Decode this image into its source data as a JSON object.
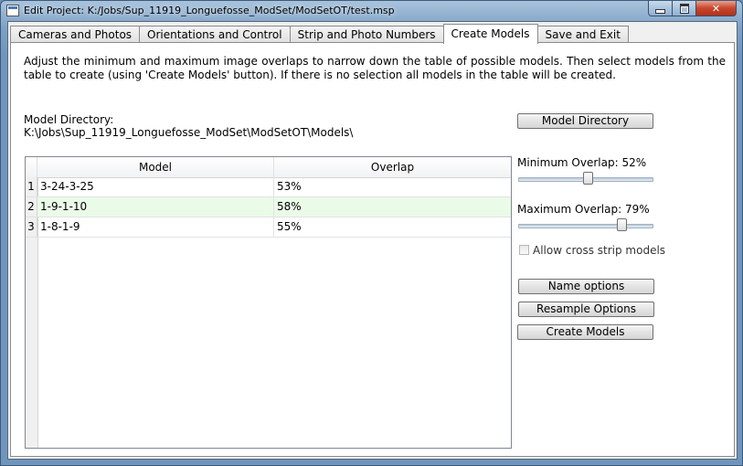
{
  "window": {
    "title": "Edit Project:  K:/Jobs/Sup_11919_Longuefosse_ModSet/ModSetOT/test.msp"
  },
  "tabs": [
    {
      "label": "Cameras and Photos",
      "active": false
    },
    {
      "label": "Orientations and Control",
      "active": false
    },
    {
      "label": "Strip and Photo Numbers",
      "active": false
    },
    {
      "label": "Create Models",
      "active": true
    },
    {
      "label": "Save and Exit",
      "active": false
    }
  ],
  "panel": {
    "instructions": "Adjust the minimum and maximum image overlaps to narrow down the table of possible models.  Then select models from the table to create (using 'Create Models' button).  If there is no selection all models in the table will be created.",
    "model_directory_label": "Model Directory:",
    "model_directory_path": "K:\\Jobs\\Sup_11919_Longuefosse_ModSet\\ModSetOT\\Models\\"
  },
  "table": {
    "columns": [
      "Model",
      "Overlap"
    ],
    "rows": [
      {
        "num": "1",
        "model": "3-24-3-25",
        "overlap": "53%"
      },
      {
        "num": "2",
        "model": "1-9-1-10",
        "overlap": "58%"
      },
      {
        "num": "3",
        "model": "1-8-1-9",
        "overlap": "55%"
      }
    ]
  },
  "controls": {
    "model_directory_button": "Model Directory",
    "min_overlap_label": "Minimum Overlap: 52%",
    "min_overlap_value": 52,
    "max_overlap_label": "Maximum Overlap: 79%",
    "max_overlap_value": 79,
    "cross_strip_label": "Allow cross strip models",
    "cross_strip_checked": false,
    "name_options_button": "Name options",
    "resample_options_button": "Resample Options",
    "create_models_button": "Create Models"
  }
}
